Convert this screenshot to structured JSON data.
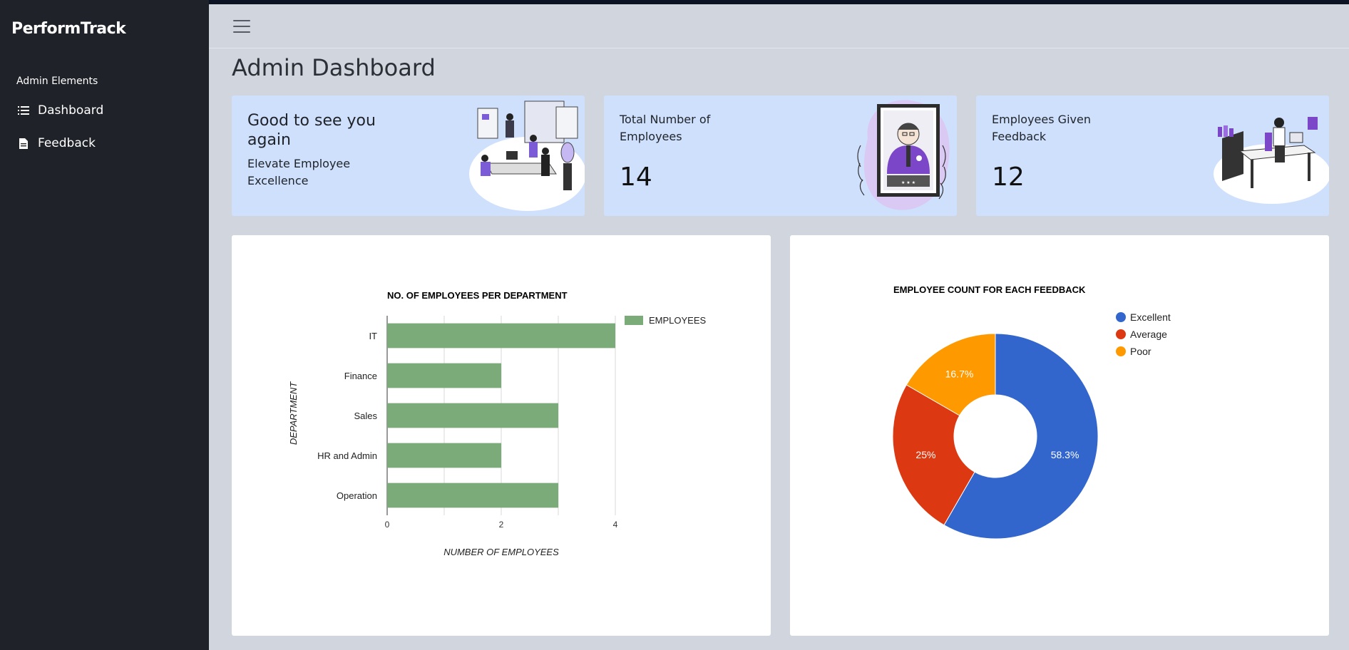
{
  "sidebar": {
    "brand": "PerformTrack",
    "section_heading": "Admin Elements",
    "items": [
      {
        "label": "Dashboard",
        "icon": "list-icon"
      },
      {
        "label": "Feedback",
        "icon": "document-icon"
      }
    ]
  },
  "topbar": {
    "menu_icon": "hamburger-icon"
  },
  "page": {
    "title": "Admin Dashboard"
  },
  "cards": {
    "welcome": {
      "title": "Good to see you again",
      "subtitle": "Elevate Employee Excellence"
    },
    "total": {
      "label": "Total Number of Employees",
      "value": "14"
    },
    "feedback": {
      "label": "Employees Given Feedback",
      "value": "12"
    }
  },
  "colors": {
    "bar": "#7bab79",
    "excellent": "#3366cc",
    "average": "#dc3912",
    "poor": "#ff9900"
  },
  "chart_data": [
    {
      "type": "bar",
      "orientation": "horizontal",
      "title": "NO. OF EMPLOYEES PER DEPARTMENT",
      "xlabel": "NUMBER OF EMPLOYEES",
      "ylabel": "DEPARTMENT",
      "categories": [
        "IT",
        "Finance",
        "Sales",
        "HR and Admin",
        "Operation"
      ],
      "series": [
        {
          "name": "EMPLOYEES",
          "values": [
            4,
            2,
            3,
            2,
            3
          ]
        }
      ],
      "xlim": [
        0,
        4
      ],
      "xticks": [
        "0",
        "2",
        "4"
      ],
      "grid": true,
      "legend": "right"
    },
    {
      "type": "pie",
      "donut": true,
      "title": "EMPLOYEE COUNT FOR EACH FEEDBACK",
      "labels": [
        "Excellent",
        "Average",
        "Poor"
      ],
      "values": [
        7,
        3,
        2
      ],
      "percent_labels": [
        "58.3%",
        "25%",
        "16.7%"
      ],
      "legend": "right"
    }
  ]
}
